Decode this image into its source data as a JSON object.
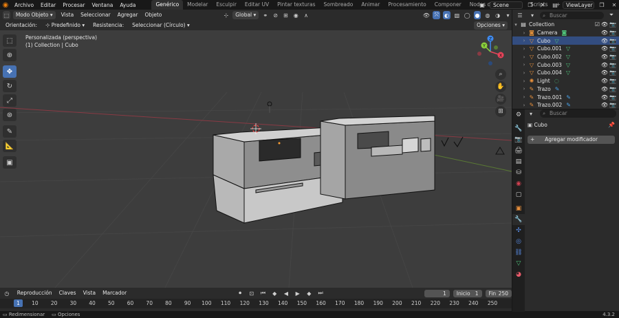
{
  "topbar": {
    "menus": [
      "Archivo",
      "Editar",
      "Procesar",
      "Ventana",
      "Ayuda"
    ],
    "workspaces": [
      "Genérico",
      "Modelar",
      "Esculpir",
      "Editar UV",
      "Pintar texturas",
      "Sombreado",
      "Animar",
      "Procesamiento",
      "Componer",
      "Nodos de geometría",
      "Scripts"
    ],
    "active_workspace": "Genérico",
    "add_tab": "+",
    "scene": "Scene",
    "view_layer": "ViewLayer"
  },
  "viewport_header": {
    "mode": "Modo Objeto",
    "menus": [
      "Vista",
      "Seleccionar",
      "Agregar",
      "Objeto"
    ],
    "transform_orientation": "Global"
  },
  "tool_header": {
    "orientation_label": "Orientación:",
    "orientation_value": "Predefinido",
    "drag_label": "Resistencia:",
    "drag_value": "Seleccionar (Círculo)",
    "options": "Opciones"
  },
  "viewport": {
    "view_name": "Personalizada (perspectiva)",
    "collection_info": "(1) Collection | Cubo"
  },
  "gizmo": {
    "x": "X",
    "y": "Y",
    "z": "Z"
  },
  "outliner": {
    "search_placeholder": "Buscar",
    "collection": "Collection",
    "items": [
      {
        "name": "Camera",
        "icon": "camera-icon",
        "selected": false
      },
      {
        "name": "Cubo",
        "icon": "mesh-icon",
        "selected": true
      },
      {
        "name": "Cubo.001",
        "icon": "mesh-icon",
        "selected": false
      },
      {
        "name": "Cubo.002",
        "icon": "mesh-icon",
        "selected": false
      },
      {
        "name": "Cubo.003",
        "icon": "mesh-icon",
        "selected": false
      },
      {
        "name": "Cubo.004",
        "icon": "mesh-icon",
        "selected": false
      },
      {
        "name": "Light",
        "icon": "light-icon",
        "selected": false
      },
      {
        "name": "Trazo",
        "icon": "grease-pencil-icon",
        "selected": false
      },
      {
        "name": "Trazo.001",
        "icon": "grease-pencil-icon",
        "selected": false
      },
      {
        "name": "Trazo.002",
        "icon": "grease-pencil-icon",
        "selected": false
      }
    ]
  },
  "properties": {
    "search_placeholder": "Buscar",
    "object_name": "Cubo",
    "add_modifier": "Agregar modificador"
  },
  "timeline": {
    "menus": [
      "Reproducción",
      "Claves",
      "Vista",
      "Marcador"
    ],
    "current_frame": "1",
    "start_label": "Inicio",
    "start_value": "1",
    "end_label": "Fin",
    "end_value": "250",
    "ruler_current": "1",
    "ticks": [
      "10",
      "20",
      "30",
      "40",
      "50",
      "60",
      "70",
      "80",
      "90",
      "100",
      "110",
      "120",
      "130",
      "140",
      "150",
      "160",
      "170",
      "180",
      "190",
      "200",
      "210",
      "220",
      "230",
      "240",
      "250"
    ]
  },
  "statusbar": {
    "items": [
      "Redimensionar",
      "Opciones"
    ],
    "version": "4.3.2"
  },
  "colors": {
    "accent": "#4772b3",
    "viewport_bg": "#3d3d3d",
    "panel_bg": "#2b2b2b",
    "selected_row": "#334d80",
    "axis_x": "#e8445a",
    "axis_y": "#8bd13c",
    "axis_z": "#3f8bf0"
  }
}
